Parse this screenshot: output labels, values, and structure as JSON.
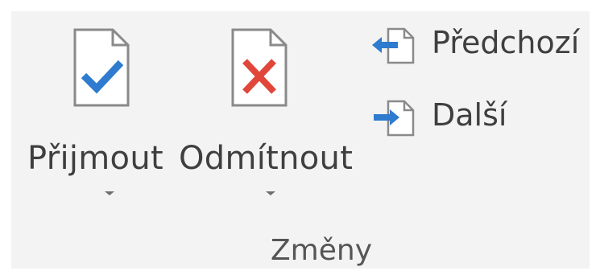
{
  "ribbon": {
    "group_label": "Změny",
    "accept": {
      "label": "Přijmout",
      "icon": "accept-document-icon"
    },
    "reject": {
      "label": "Odmítnout",
      "icon": "reject-document-icon"
    },
    "previous": {
      "label": "Předchozí",
      "icon": "previous-change-icon"
    },
    "next": {
      "label": "Další",
      "icon": "next-change-icon"
    }
  },
  "colors": {
    "background": "#f3f3f3",
    "check_blue": "#2e7bcf",
    "cross_red": "#e0463a",
    "arrow_blue": "#2e7bcf",
    "doc_outline": "#8a8a8a"
  }
}
